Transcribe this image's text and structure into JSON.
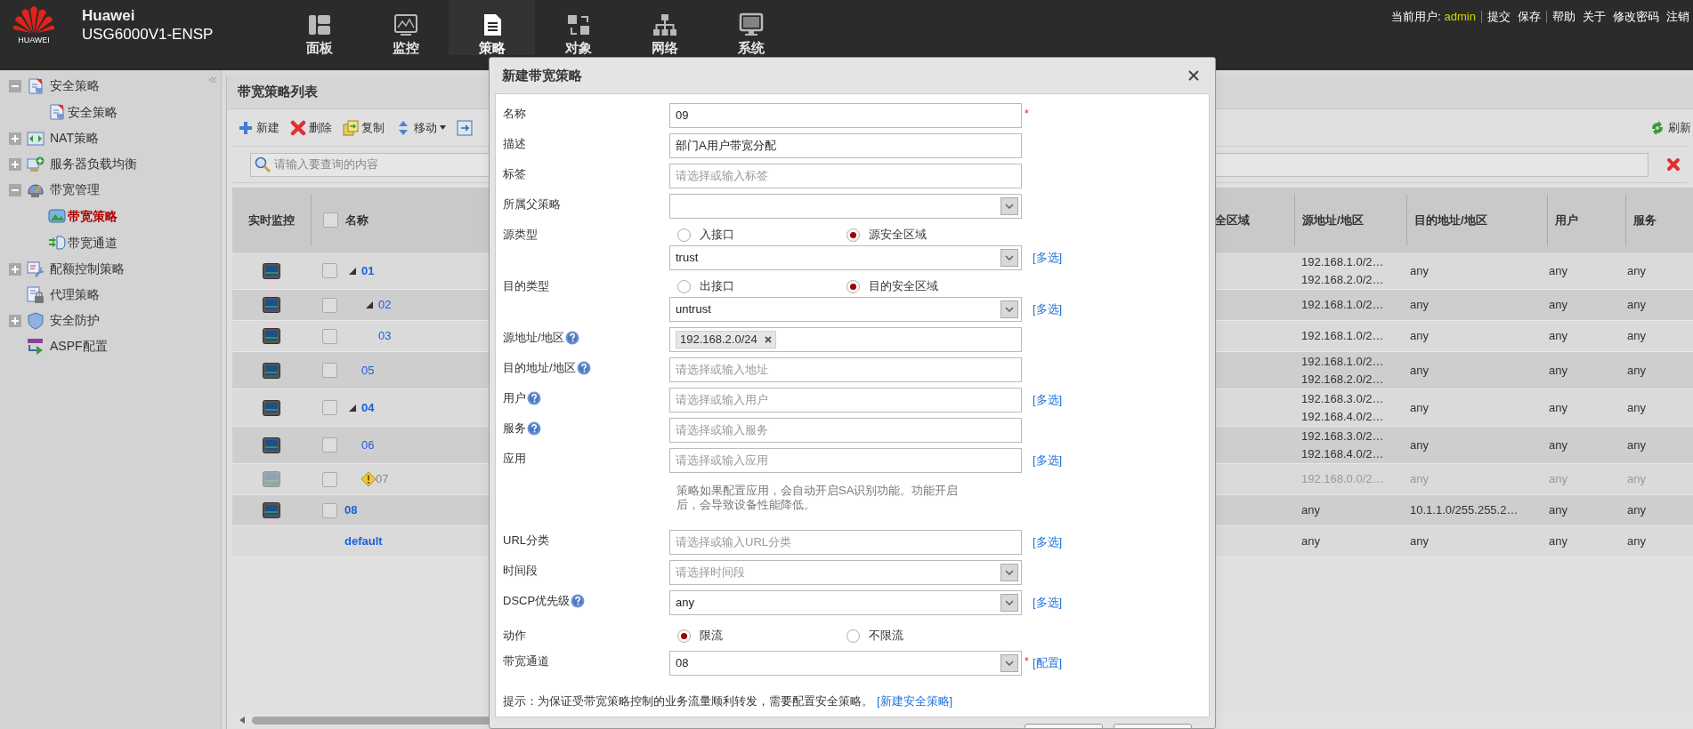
{
  "header": {
    "logo_text": "HUAWEI",
    "brand": "Huawei",
    "model": "USG6000V1-ENSP",
    "nav": [
      {
        "label": "面板",
        "kind": "dashboard",
        "selected": false
      },
      {
        "label": "监控",
        "kind": "monitor",
        "selected": false
      },
      {
        "label": "策略",
        "kind": "document",
        "selected": true
      },
      {
        "label": "对象",
        "kind": "object",
        "selected": false
      },
      {
        "label": "网络",
        "kind": "network",
        "selected": false
      },
      {
        "label": "系统",
        "kind": "system",
        "selected": false
      }
    ],
    "user_label": "当前用户:",
    "user": "admin",
    "link_groups": [
      [
        "提交",
        "保存"
      ],
      [
        "帮助",
        "关于",
        "修改密码",
        "注销"
      ]
    ]
  },
  "sidebar": {
    "items": [
      {
        "label": "安全策略",
        "kind": "document",
        "expanded": true,
        "selected": false,
        "children": [
          {
            "label": "安全策略",
            "kind": "document",
            "selected": false
          }
        ]
      },
      {
        "label": "NAT策略",
        "kind": "arrows",
        "expanded": false,
        "selected": false
      },
      {
        "label": "服务器负载均衡",
        "kind": "computer",
        "expanded": false,
        "selected": false
      },
      {
        "label": "带宽管理",
        "kind": "gauge",
        "expanded": true,
        "selected": false,
        "children": [
          {
            "label": "带宽策略",
            "kind": "image",
            "selected": true
          },
          {
            "label": "带宽通道",
            "kind": "channel",
            "selected": false
          }
        ]
      },
      {
        "label": "配额控制策略",
        "kind": "wrench",
        "expanded": false,
        "selected": false
      },
      {
        "label": "代理策略",
        "kind": "lock",
        "selected": false
      },
      {
        "label": "安全防护",
        "kind": "shield",
        "expanded": false,
        "selected": false
      },
      {
        "label": "ASPF配置",
        "kind": "aspf",
        "selected": false
      }
    ]
  },
  "main": {
    "title": "带宽策略列表",
    "toolbar": [
      {
        "label": "新建",
        "kind": "add",
        "dropdown": false
      },
      {
        "label": "删除",
        "kind": "delete",
        "dropdown": false
      },
      {
        "label": "复制",
        "kind": "copy",
        "dropdown": false
      },
      {
        "label": "移动",
        "kind": "move",
        "dropdown": true
      },
      {
        "kind": "export",
        "dropdown": false
      }
    ],
    "refresh": "刷新",
    "search": {
      "placeholder": "请输入要查询的内容"
    },
    "table": {
      "columns": [
        "实时监控",
        "名称",
        "全区域",
        "源地址/地区",
        "目的地址/地区",
        "用户",
        "服务"
      ],
      "select_all_checked": false,
      "rows": [
        {
          "name": "01",
          "kind": "policy",
          "checked": false,
          "disabled": false,
          "expanded": true,
          "source": [
            "192.168.1.0/2…",
            "192.168.2.0/2…"
          ],
          "destination": "any",
          "user": "any",
          "service": "any",
          "children": [
            {
              "name": "02",
              "kind": "policy",
              "checked": false,
              "disabled": false,
              "expanded": true,
              "source": [
                "192.168.1.0/2…"
              ],
              "destination": "any",
              "user": "any",
              "service": "any",
              "children": [
                {
                  "name": "03",
                  "kind": "policy",
                  "checked": false,
                  "disabled": false,
                  "source": [
                    "192.168.1.0/2…"
                  ],
                  "destination": "any",
                  "user": "any",
                  "service": "any"
                }
              ]
            },
            {
              "name": "05",
              "kind": "policy",
              "checked": false,
              "disabled": false,
              "source": [
                "192.168.1.0/2…",
                "192.168.2.0/2…"
              ],
              "destination": "any",
              "user": "any",
              "service": "any"
            }
          ]
        },
        {
          "name": "04",
          "kind": "policy",
          "checked": false,
          "disabled": false,
          "expanded": true,
          "source": [
            "192.168.3.0/2…",
            "192.168.4.0/2…"
          ],
          "destination": "any",
          "user": "any",
          "service": "any",
          "children": [
            {
              "name": "06",
              "kind": "policy",
              "checked": false,
              "disabled": false,
              "source": [
                "192.168.3.0/2…",
                "192.168.4.0/2…"
              ],
              "destination": "any",
              "user": "any",
              "service": "any"
            },
            {
              "name": "07",
              "kind": "policy",
              "checked": false,
              "disabled": true,
              "source": [
                "192.168.0.0/2…"
              ],
              "destination": "any",
              "user": "any",
              "service": "any"
            }
          ]
        },
        {
          "name": "08",
          "kind": "policy",
          "checked": false,
          "disabled": false,
          "source": [
            "any"
          ],
          "destination": "10.1.1.0/255.255.2…",
          "user": "any",
          "service": "any"
        },
        {
          "name": "default",
          "kind": "default",
          "source": [
            "any"
          ],
          "destination": "any",
          "user": "any",
          "service": "any"
        }
      ]
    }
  },
  "dialog": {
    "title": "新建带宽策略",
    "fields": [
      {
        "kind": "text",
        "label": "名称",
        "value": "09",
        "required_mark": "*"
      },
      {
        "kind": "text",
        "label": "描述",
        "value": "部门A用户带宽分配"
      },
      {
        "kind": "text",
        "label": "标签",
        "placeholder": "请选择或输入标签"
      },
      {
        "kind": "select",
        "label": "所属父策略"
      },
      {
        "kind": "radio",
        "label": "源类型",
        "options": [
          {
            "label": "入接口",
            "selected": false
          },
          {
            "label": "源安全区域",
            "selected": true
          }
        ]
      },
      {
        "kind": "select",
        "value": "trust",
        "link": "[多选]"
      },
      {
        "kind": "radio",
        "label": "目的类型",
        "options": [
          {
            "label": "出接口",
            "selected": false
          },
          {
            "label": "目的安全区域",
            "selected": true
          }
        ]
      },
      {
        "kind": "select",
        "value": "untrust",
        "link": "[多选]"
      },
      {
        "kind": "tags",
        "label": "源地址/地区",
        "help": true,
        "tags": [
          "192.168.2.0/24"
        ]
      },
      {
        "kind": "text",
        "label": "目的地址/地区",
        "help": true,
        "placeholder": "请选择或输入地址"
      },
      {
        "kind": "text",
        "label": "用户",
        "help": true,
        "placeholder": "请选择或输入用户",
        "link": "[多选]"
      },
      {
        "kind": "text",
        "label": "服务",
        "help": true,
        "placeholder": "请选择或输入服务"
      },
      {
        "kind": "text",
        "label": "应用",
        "placeholder": "请选择或输入应用",
        "link": "[多选]"
      },
      {
        "kind": "note",
        "text": "策略如果配置应用，会自动开启SA识别功能。功能开启后，会导致设备性能降低。"
      },
      {
        "kind": "text",
        "label": "URL分类",
        "placeholder": "请选择或输入URL分类",
        "link": "[多选]"
      },
      {
        "kind": "select",
        "label": "时间段",
        "placeholder": "请选择时间段"
      },
      {
        "kind": "select",
        "label": "DSCP优先级",
        "help": true,
        "value": "any",
        "link": "[多选]"
      },
      {
        "kind": "radio",
        "label": "动作",
        "options": [
          {
            "label": "限流",
            "selected": true
          },
          {
            "label": "不限流",
            "selected": false
          }
        ]
      },
      {
        "kind": "select",
        "label": "带宽通道",
        "value": "08",
        "required_mark": "*",
        "link": "[配置]"
      }
    ],
    "hint": "提示：为保证受带宽策略控制的业务流量顺利转发，需要配置安全策略。",
    "hint_link": "[新建安全策略]",
    "footer_buttons": [
      {
        "kind": "button"
      },
      {
        "kind": "button"
      }
    ]
  }
}
